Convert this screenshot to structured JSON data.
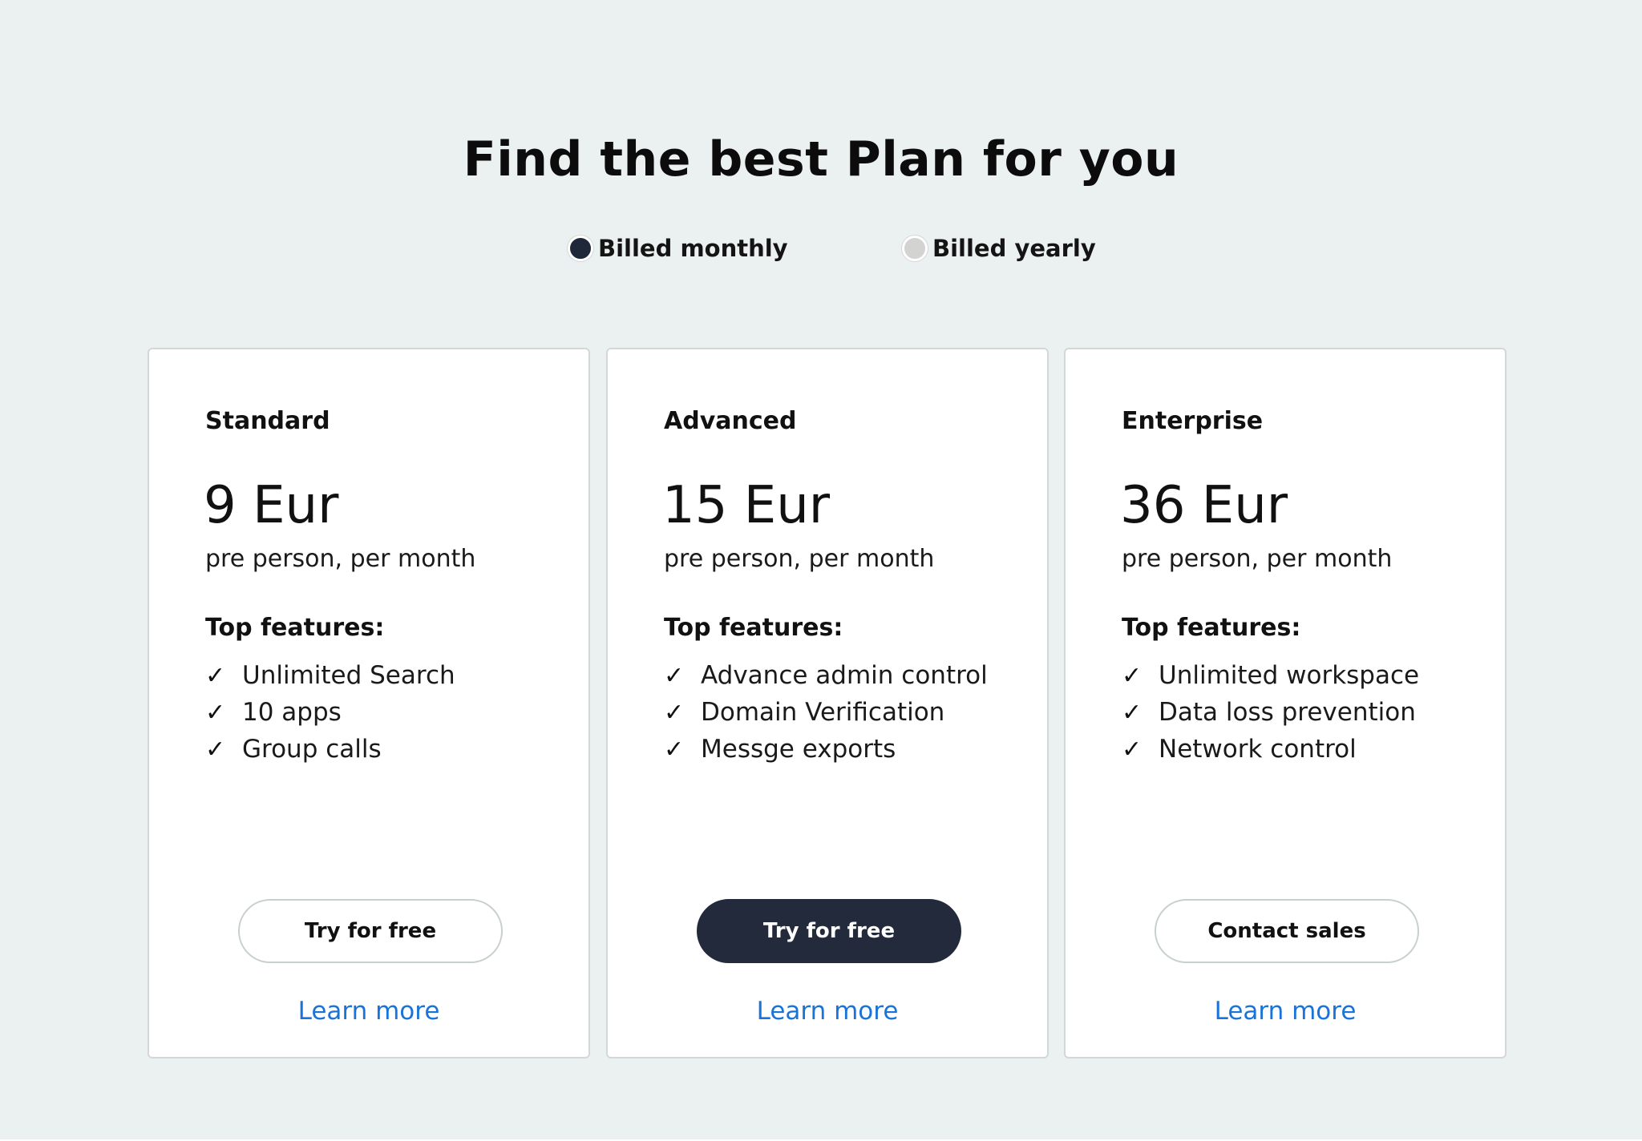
{
  "header": {
    "title": "Find the best Plan for you"
  },
  "billing": {
    "options": [
      {
        "label": "Billed monthly",
        "selected": true
      },
      {
        "label": "Billed yearly",
        "selected": false
      }
    ]
  },
  "plans": [
    {
      "name": "Standard",
      "price": "9 Eur",
      "price_note": "pre person, per month",
      "features_heading": "Top features:",
      "features": [
        "Unlimited Search",
        "10 apps",
        "Group calls"
      ],
      "cta_label": "Try for free",
      "link_label": "Learn more"
    },
    {
      "name": "Advanced",
      "price": "15 Eur",
      "price_note": "pre person, per month",
      "features_heading": "Top features:",
      "features": [
        "Advance admin control",
        "Domain Verification",
        "Messge exports"
      ],
      "cta_label": "Try for free",
      "link_label": "Learn more"
    },
    {
      "name": "Enterprise",
      "price": "36 Eur",
      "price_note": "pre person, per month",
      "features_heading": "Top features:",
      "features": [
        "Unlimited workspace",
        "Data loss prevention",
        "Network control"
      ],
      "cta_label": "Contact sales",
      "link_label": "Learn more"
    }
  ],
  "icons": {
    "check": "✓"
  },
  "colors": {
    "background": "#ebf0f0",
    "primary_button": "#222a3b",
    "link": "#1a73d9",
    "radio_selected": "#1f2839",
    "radio_unselected": "#d3d3d1"
  }
}
